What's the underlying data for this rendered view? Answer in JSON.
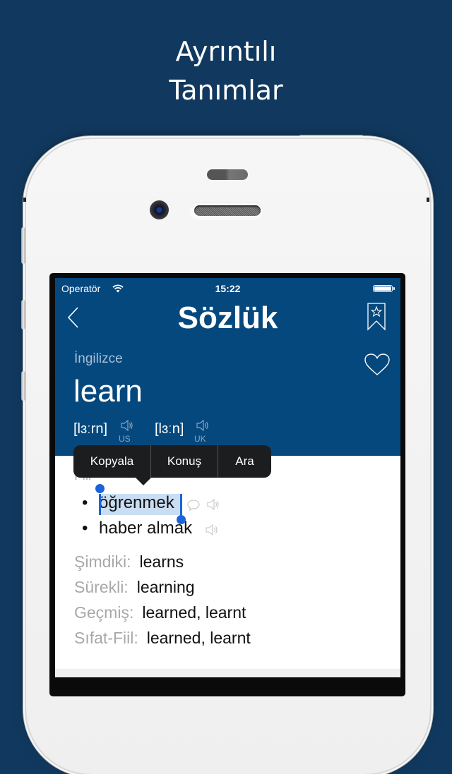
{
  "promo": {
    "line1": "Ayrıntılı",
    "line2": "Tanımlar"
  },
  "status_bar": {
    "carrier": "Operatör",
    "time": "15:22",
    "wifi_icon": "wifi-icon",
    "battery_icon": "battery-full-icon"
  },
  "nav": {
    "title": "Sözlük",
    "back_icon": "chevron-left-icon",
    "bookmark_icon": "bookmark-star-icon"
  },
  "entry": {
    "language": "İngilizce",
    "headword": "learn",
    "favorite_icon": "heart-outline-icon",
    "pronunciations": [
      {
        "ipa": "[lɜːrn]",
        "accent": "US",
        "icon": "speaker-icon"
      },
      {
        "ipa": "[lɜːn]",
        "accent": "UK",
        "icon": "speaker-icon"
      }
    ],
    "part_of_speech": "Fiil",
    "senses": [
      {
        "bullet": "•",
        "text": "öğrenmek",
        "selected": true,
        "icons": [
          "speech-bubble-icon",
          "speaker-icon"
        ]
      },
      {
        "bullet": "•",
        "text": "haber almak",
        "selected": false,
        "icons": [
          "speaker-icon"
        ]
      }
    ],
    "inflections": [
      {
        "label": "Şimdiki:",
        "value": "learns"
      },
      {
        "label": "Sürekli:",
        "value": "learning"
      },
      {
        "label": "Geçmiş:",
        "value": "learned, learnt"
      },
      {
        "label": "Sıfat-Fiil:",
        "value": "learned, learnt"
      }
    ]
  },
  "context_menu": {
    "items": [
      "Kopyala",
      "Konuş",
      "Ara"
    ]
  },
  "colors": {
    "background": "#11395f",
    "header": "#05487e",
    "selection": "#c9ddf3",
    "selection_handle": "#1a63d8",
    "menu": "#1c1d1f"
  }
}
